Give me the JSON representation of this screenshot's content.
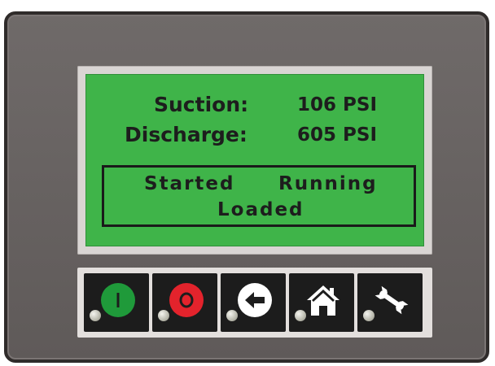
{
  "display": {
    "suction_label": "Suction:",
    "suction_value": "106 PSI",
    "discharge_label": "Discharge:",
    "discharge_value": "605 PSI",
    "status_started": "Started",
    "status_running": "Running",
    "status_loaded": "Loaded"
  },
  "buttons": [
    {
      "icon": "start-icon",
      "symbol": "I",
      "color": "#1f9a3a"
    },
    {
      "icon": "stop-icon",
      "symbol": "O",
      "color": "#e3232c"
    },
    {
      "icon": "back-arrow-icon",
      "color": "#ffffff"
    },
    {
      "icon": "home-icon",
      "color": "#ffffff"
    },
    {
      "icon": "wrench-icon",
      "color": "#ffffff"
    }
  ],
  "colors": {
    "lcd_green": "#3fb449",
    "housing": "#666160",
    "button_bezel": "#e3dfdd"
  }
}
